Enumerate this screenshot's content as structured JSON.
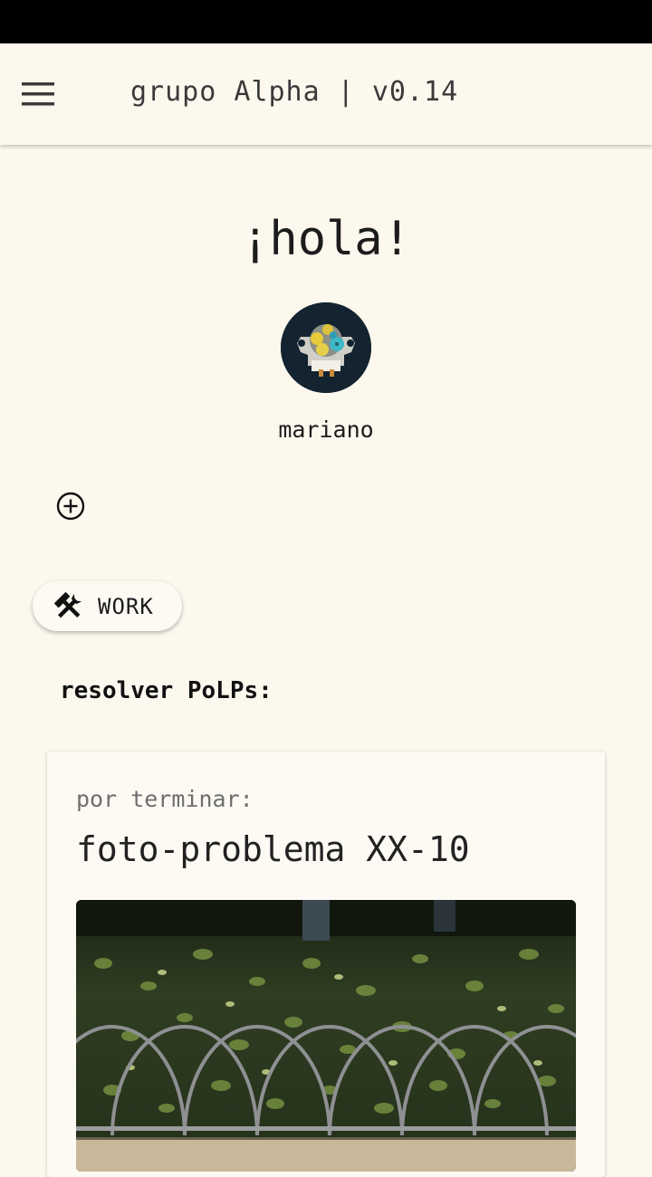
{
  "header": {
    "menu_icon": "hamburger-menu-icon",
    "title": "grupo Alpha | v0.14"
  },
  "greeting": "¡hola!",
  "user": {
    "name": "mariano",
    "avatar_icon": "gear-motor-avatar"
  },
  "add_icon": "plus-circle-icon",
  "work_chip": {
    "icon": "hammer-wrench-icon",
    "label": "WORK"
  },
  "section": {
    "title": "resolver PoLPs:"
  },
  "card": {
    "status": "por terminar:",
    "title": "foto-problema XX-10",
    "image": "photo-hedge-with-metal-arch-fence"
  },
  "colors": {
    "background": "#fcf8ee",
    "statusbar": "#000000",
    "text": "#1b1b1b",
    "muted_text": "#6e6e6e"
  }
}
